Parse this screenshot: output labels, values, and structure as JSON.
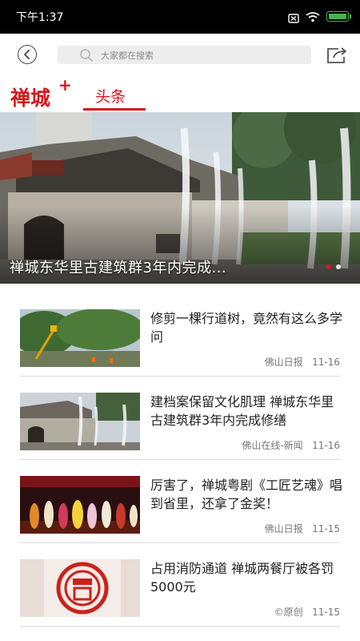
{
  "status_bar": {
    "time": "下午1:37"
  },
  "top_nav": {
    "search_placeholder": "大家都在搜索"
  },
  "channel": {
    "logo_text": "禅城",
    "logo_plus": "+",
    "tab_label": "头条",
    "accent_color": "#d2191e"
  },
  "hero": {
    "caption": "禅城东华里古建筑群3年内完成...",
    "slide_count": 3,
    "active_slide": 1
  },
  "news": [
    {
      "title": "修剪一棵行道树，竟然有这么多学问",
      "source": "佛山日报",
      "date": "11-16",
      "thumb": "tree-trimming-photo"
    },
    {
      "title": "建档案保留文化肌理 禅城东华里古建筑群3年内完成修缮",
      "source": "佛山在线-新闻",
      "date": "11-16",
      "thumb": "ancient-building-fountain-photo"
    },
    {
      "title": "厉害了，禅城粤剧《工匠艺魂》唱到省里，还拿了金奖！",
      "source": "佛山日报",
      "date": "11-15",
      "thumb": "cantonese-opera-stage-photo"
    },
    {
      "title": "占用消防通道 禅城两餐厅被各罚5000元",
      "source": "©原创",
      "date": "11-15",
      "thumb": "fine-stamp-photo"
    }
  ]
}
